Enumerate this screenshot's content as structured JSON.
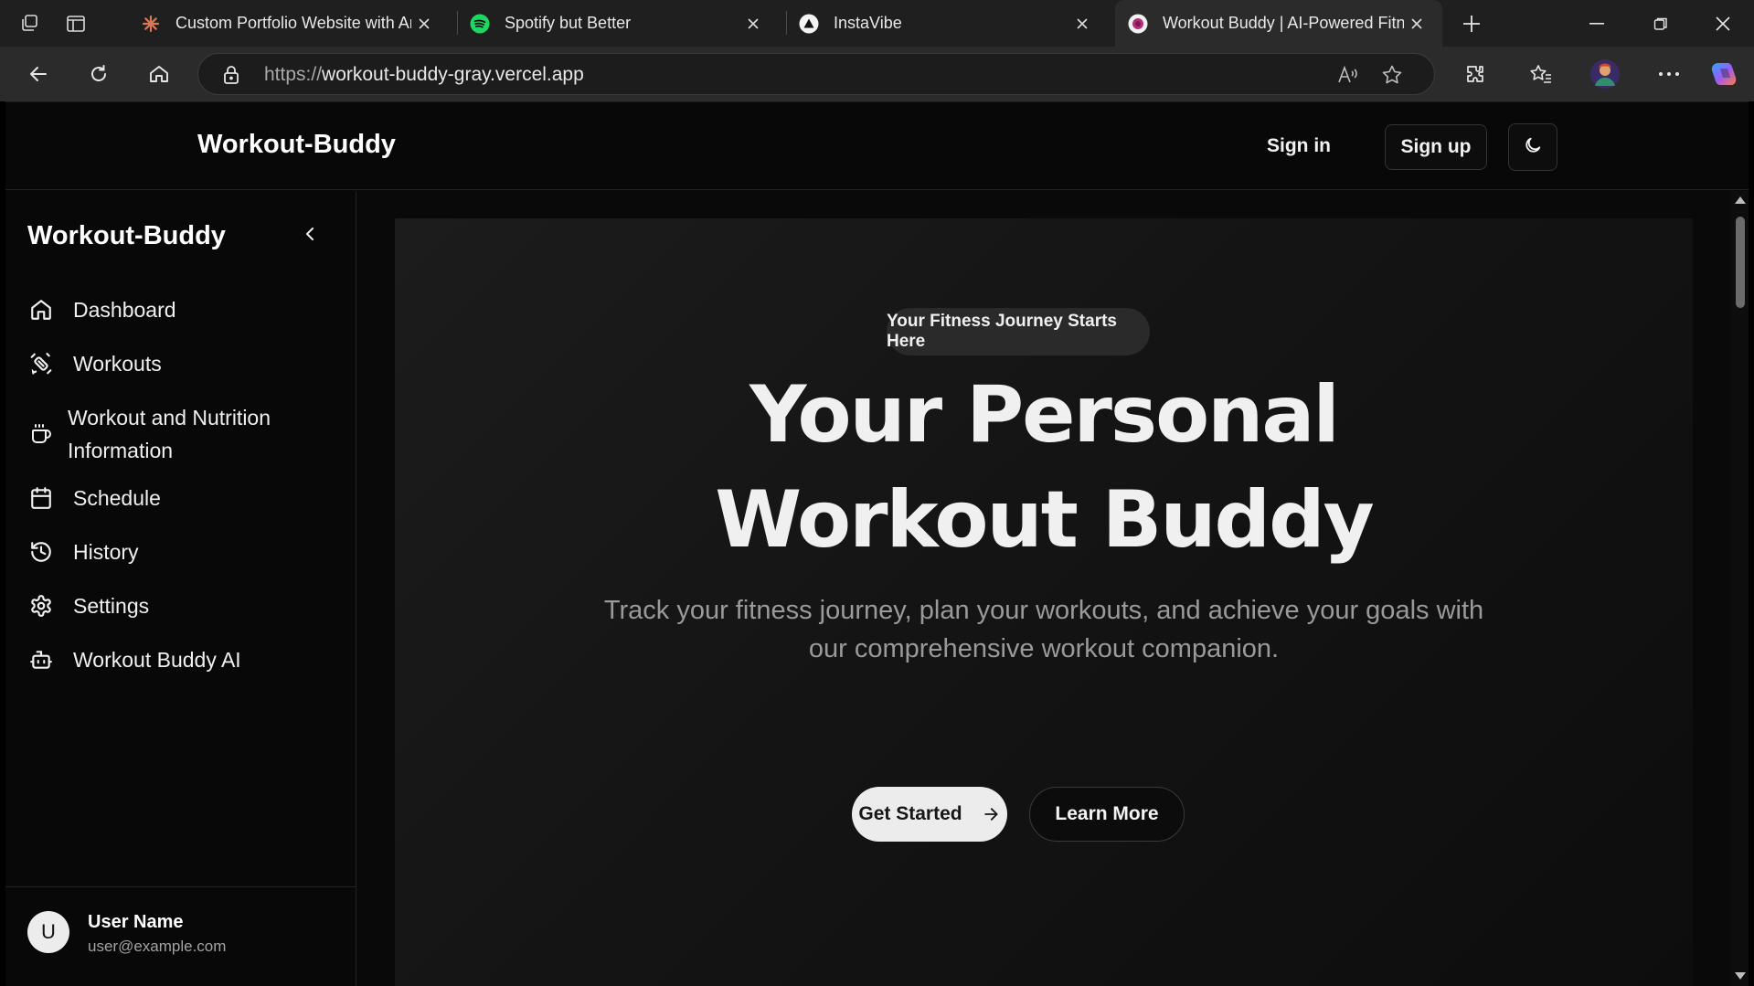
{
  "browser": {
    "tabs": [
      {
        "title": "Custom Portfolio Website with An",
        "favicon": "asterisk-favicon",
        "active": false
      },
      {
        "title": "Spotify but Better",
        "favicon": "spotify-favicon",
        "active": false
      },
      {
        "title": "InstaVibe",
        "favicon": "triangle-favicon",
        "active": false
      },
      {
        "title": "Workout Buddy | AI-Powered Fitn",
        "favicon": "workout-buddy-favicon",
        "active": true
      }
    ],
    "address": {
      "scheme": "https://",
      "host": "workout-buddy-gray.vercel.app"
    },
    "colors": {
      "chrome_bg": "#1f1f1f",
      "toolbar_bg": "#2b2b2b",
      "spotify_green": "#1ed760",
      "claude_orange": "#d97757"
    }
  },
  "header": {
    "brand": "Workout-Buddy",
    "sign_in": "Sign in",
    "sign_up": "Sign up",
    "theme_toggle_icon": "moon-icon"
  },
  "sidebar": {
    "brand": "Workout-Buddy",
    "items": [
      {
        "label": "Dashboard",
        "icon": "home-icon"
      },
      {
        "label": "Workouts",
        "icon": "dumbbell-icon"
      },
      {
        "label": "Workout and Nutrition Information",
        "label_line1": "Workout and Nutrition",
        "label_line2": "Information",
        "icon": "coffee-cup-icon"
      },
      {
        "label": "Schedule",
        "icon": "calendar-icon"
      },
      {
        "label": "History",
        "icon": "history-icon"
      },
      {
        "label": "Settings",
        "icon": "gear-icon"
      },
      {
        "label": "Workout Buddy AI",
        "icon": "bot-icon"
      }
    ],
    "user": {
      "initial": "U",
      "name": "User Name",
      "email": "user@example.com"
    }
  },
  "hero": {
    "badge": "Your Fitness Journey Starts Here",
    "title_line1": "Your Personal",
    "title_line2": "Workout Buddy",
    "subtitle_line1": "Track your fitness journey, plan your workouts, and achieve your goals with",
    "subtitle_line2": "our comprehensive workout companion.",
    "cta_primary": "Get Started",
    "cta_secondary": "Learn More"
  },
  "theme": {
    "page_bg": "#090909",
    "hero_bg": "#1a1a1a",
    "primary_button_bg": "#ececec",
    "text_muted": "#9a9a9a"
  }
}
